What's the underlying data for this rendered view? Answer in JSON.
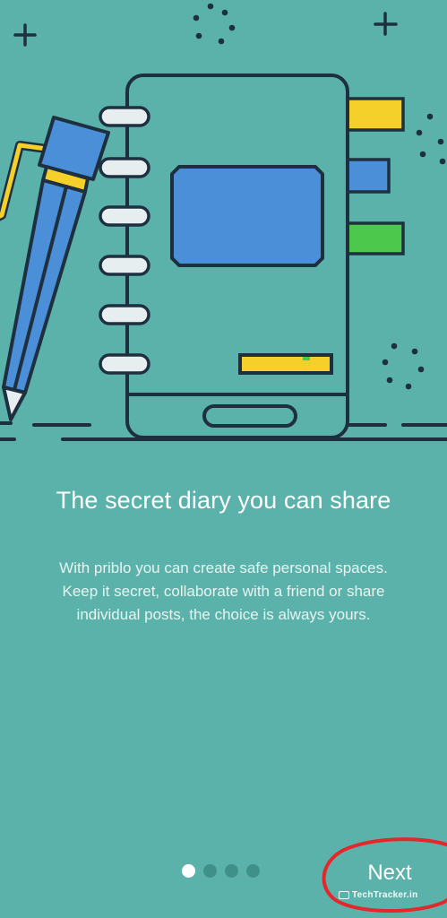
{
  "onboarding": {
    "title": "The secret diary you can share",
    "description_lines": [
      "With priblo you can create safe personal spaces.",
      "Keep it secret, collaborate with a friend or share",
      "individual posts, the choice is always yours."
    ],
    "next_label": "Next",
    "page_indicator": {
      "total": 4,
      "active_index": 0
    }
  },
  "watermark": {
    "text": "TechTracker.in"
  },
  "colors": {
    "background": "#5bb2aa",
    "outline": "#1e3040",
    "notebook": "#5bb2aa",
    "label_blue": "#4a8fd8",
    "tab_yellow": "#f5d02a",
    "tab_green": "#4cc94c",
    "ring": "#e6eef0",
    "annotation_red": "#e5262b"
  }
}
